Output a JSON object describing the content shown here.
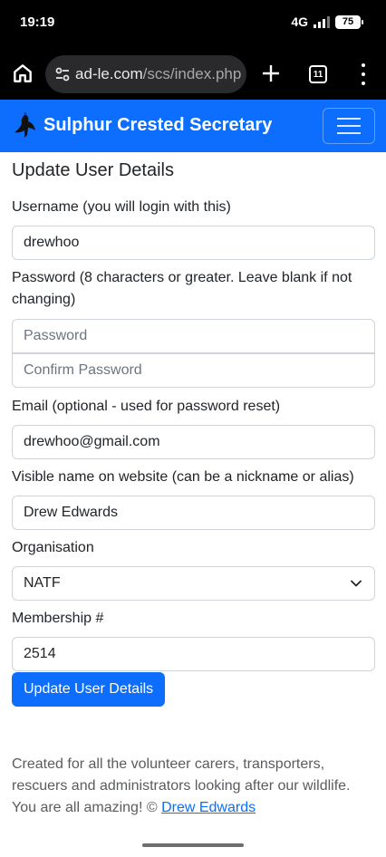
{
  "status_bar": {
    "time": "19:19",
    "network": "4G",
    "battery": "75"
  },
  "browser": {
    "url_domain": "ad-le.com",
    "url_path": "/scs/index.php",
    "tab_count": "11"
  },
  "navbar": {
    "brand": "Sulphur Crested Secretary",
    "accent": "#0d6efd"
  },
  "form": {
    "title": "Update User Details",
    "username_label": "Username (you will login with this)",
    "username_value": "drewhoo",
    "password_label": "Password (8 characters or greater. Leave blank if not changing)",
    "password_placeholder": "Password",
    "confirm_placeholder": "Confirm Password",
    "email_label": "Email (optional - used for password reset)",
    "email_value": "drewhoo@gmail.com",
    "visible_name_label": "Visible name on website (can be a nickname or alias)",
    "visible_name_value": "Drew Edwards",
    "organisation_label": "Organisation",
    "organisation_value": "NATF",
    "membership_label": "Membership #",
    "membership_value": "2514",
    "submit_label": "Update User Details"
  },
  "footer": {
    "text": "Created for all the volunteer carers, transporters, rescuers and administrators looking after our wildlife. You are all amazing! © ",
    "link": "Drew Edwards"
  }
}
